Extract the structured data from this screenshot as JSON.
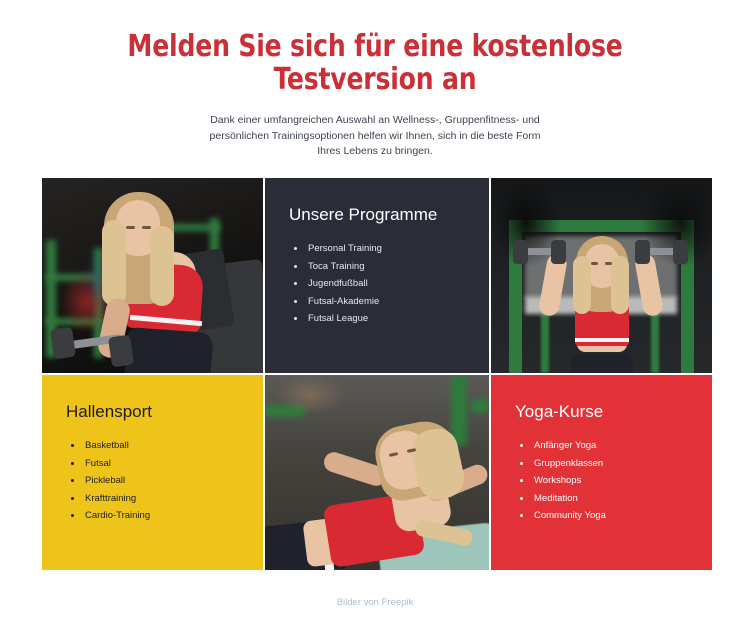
{
  "header": {
    "title": "Melden Sie sich für eine kostenlose Testversion an",
    "subtitle": "Dank einer umfangreichen Auswahl an Wellness-, Gruppenfitness- und persönlichen Trainingsoptionen helfen wir Ihnen, sich in die beste Form Ihres Lebens zu bringen."
  },
  "theme": {
    "accent_red": "#CB3038",
    "panel_dark": "#2A2D37",
    "panel_yellow": "#EFC41A",
    "panel_red": "#E23237",
    "body_text": "#3E4450",
    "footer_link": "#A7BDD4"
  },
  "grid": {
    "cells": [
      {
        "kind": "image",
        "name": "gym-dumbbell-curl-photo",
        "alt": "Frau mit Kurzhantel auf einer Hantelbank im Fitnessstudio"
      },
      {
        "kind": "panel",
        "style": "dark",
        "name": "programme-panel",
        "title": "Unsere Programme",
        "items": [
          "Personal Training",
          "Toca Training",
          "Jugendfußball",
          "Futsal-Akademie",
          "Futsal League"
        ]
      },
      {
        "kind": "image",
        "name": "gym-shoulder-press-photo",
        "alt": "Frau beim Schulterdrücken mit Kurzhanteln vor grünem Power Rack"
      },
      {
        "kind": "panel",
        "style": "yellow",
        "name": "hallensport-panel",
        "title": "Hallensport",
        "items": [
          "Basketball",
          "Futsal",
          "Pickleball",
          "Krafttraining",
          "Cardio-Training"
        ]
      },
      {
        "kind": "image",
        "name": "gym-situp-photo",
        "alt": "Frau beim Sit-up-Training auf dem Boden im Fitnessstudio"
      },
      {
        "kind": "panel",
        "style": "red",
        "name": "yoga-panel",
        "title": "Yoga-Kurse",
        "items": [
          "Anfänger Yoga",
          "Gruppenklassen",
          "Workshops",
          "Meditation",
          "Community Yoga"
        ]
      }
    ]
  },
  "footer": {
    "credit": "Bilder von Freepik"
  }
}
